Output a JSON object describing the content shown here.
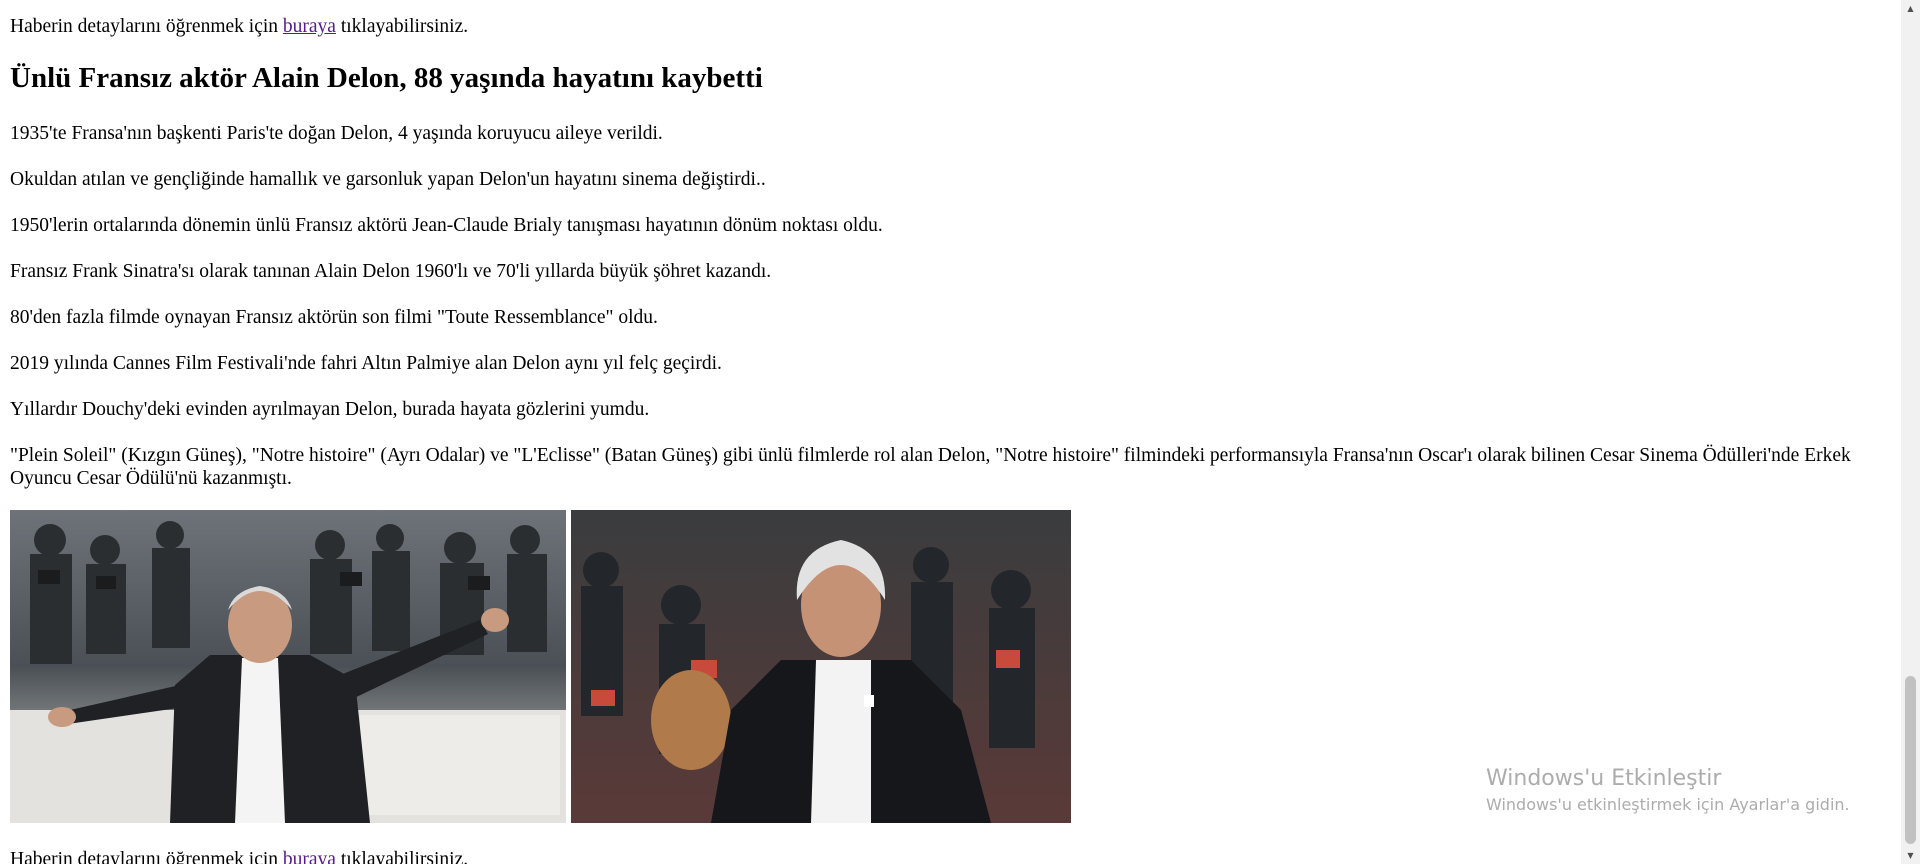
{
  "article": {
    "detail_top": {
      "prefix": "Haberin detaylarını öğrenmek için ",
      "link": "buraya",
      "suffix": " tıklayabilirsiniz."
    },
    "title": "Ünlü Fransız aktör Alain Delon, 88 yaşında hayatını kaybetti",
    "paragraphs": [
      "1935'te Fransa'nın başkenti Paris'te doğan Delon, 4 yaşında koruyucu aileye verildi.",
      "Okuldan atılan ve gençliğinde hamallık ve garsonluk yapan Delon'un hayatını sinema değiştirdi..",
      "1950'lerin ortalarında dönemin ünlü Fransız aktörü Jean-Claude Brialy tanışması hayatının dönüm noktası oldu.",
      "Fransız Frank Sinatra'sı olarak tanınan Alain Delon 1960'lı ve 70'li yıllarda büyük şöhret kazandı.",
      "80'den fazla filmde oynayan Fransız aktörün son filmi \"Toute Ressemblance\" oldu.",
      "2019 yılında Cannes Film Festivali'nde fahri Altın Palmiye alan Delon aynı yıl felç geçirdi.",
      "Yıllardır Douchy'deki evinden ayrılmayan Delon, burada hayata gözlerini yumdu."
    ],
    "long_paragraph": "\"Plein Soleil\" (Kızgın Güneş), \"Notre histoire\" (Ayrı Odalar) ve \"L'Eclisse\" (Batan Güneş) gibi ünlü filmlerde rol alan Delon, \"Notre histoire\" filmindeki performansıyla Fransa'nın Oscar'ı olarak bilinen Cesar Sinema Ödülleri'nde Erkek Oyuncu Cesar Ödülü'nü kazanmıştı.",
    "detail_bottom": {
      "prefix": "Haberin detaylarını öğrenmek için ",
      "link": "buraya",
      "suffix": " tıklayabilirsiniz."
    }
  },
  "watermark": {
    "title": "Windows'u Etkinleştir",
    "subtitle": "Windows'u etkinleştirmek için Ayarlar'a gidin."
  },
  "colors": {
    "link_visited": "#551a8b",
    "text": "#000000",
    "background": "#ffffff"
  },
  "icons": {
    "scroll_up": "scroll-up-arrow-icon",
    "scroll_down": "scroll-down-arrow-icon"
  }
}
